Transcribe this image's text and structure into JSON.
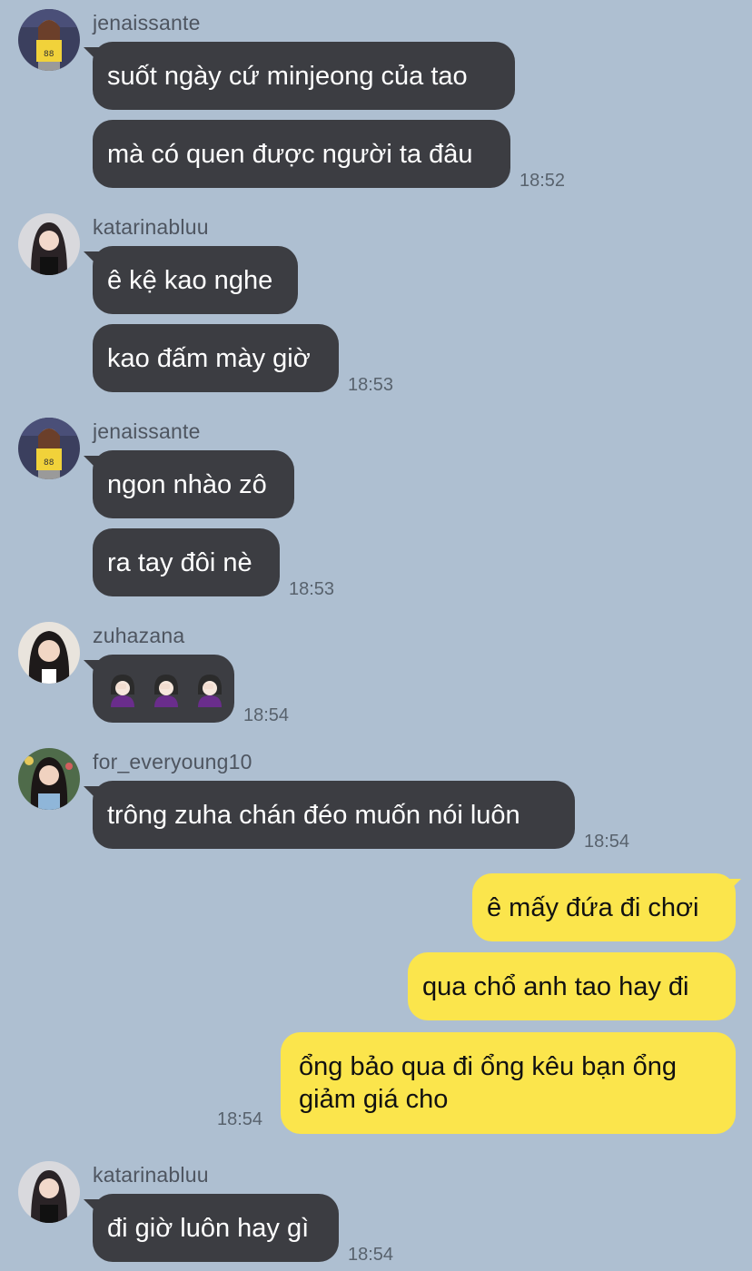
{
  "messages": [
    {
      "user": "jenaissante",
      "lines": [
        "suốt ngày cứ minjeong của tao",
        "mà có quen được người ta đâu"
      ],
      "time": "18:52"
    },
    {
      "user": "katarinabluu",
      "lines": [
        "ê kệ kao nghe",
        "kao đấm mày giờ"
      ],
      "time": "18:53"
    },
    {
      "user": "jenaissante",
      "lines": [
        "ngon nhào zô",
        "ra tay đôi nè"
      ],
      "time": "18:53"
    },
    {
      "user": "zuhazana",
      "emoji": "facepalm",
      "time": "18:54"
    },
    {
      "user": "for_everyoung10",
      "lines": [
        "trông zuha chán đéo muốn nói luôn"
      ],
      "time": "18:54"
    },
    {
      "outgoing": true,
      "lines": [
        "ê mấy đứa đi chơi",
        "qua chổ anh tao hay đi",
        "ổng bảo qua đi ổng kêu bạn ổng giảm giá cho"
      ],
      "time": "18:54"
    },
    {
      "user": "katarinabluu",
      "lines": [
        "đi giờ luôn hay gì"
      ],
      "time": "18:54"
    }
  ],
  "colors": {
    "background": "#aebfd1",
    "incoming_bubble": "#3c3d42",
    "outgoing_bubble": "#fbe54c"
  }
}
